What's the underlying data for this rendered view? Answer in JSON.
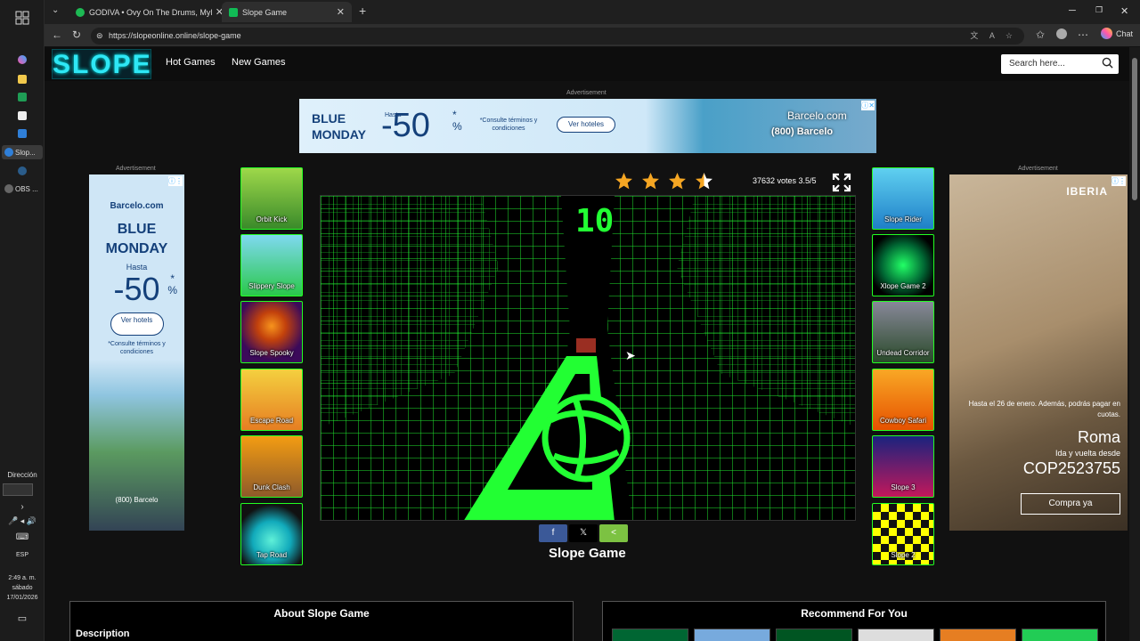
{
  "taskbar": {
    "apps": [
      {
        "label": "Slop...",
        "active": true
      },
      {
        "label": "OBS ...",
        "active": false
      }
    ],
    "direction_label": "Dirección",
    "language": "ESP",
    "time": "2:49 a. m.",
    "day": "sábado",
    "date": "17/01/2026"
  },
  "browser": {
    "tabs": [
      {
        "title": "GODIVA • Ovy On The Drums, Myl",
        "active": false
      },
      {
        "title": "Slope Game",
        "active": true
      }
    ],
    "url": "https://slopeonline.online/slope-game",
    "chat_label": "Chat"
  },
  "site": {
    "logo_text": "SLOPE",
    "nav": [
      "Hot Games",
      "New Games"
    ],
    "search_placeholder": "Search here...",
    "ad_label": "Advertisement",
    "top_ad": {
      "headline_line1": "BLUE",
      "headline_line2": "MONDAY",
      "hasta": "Hasta",
      "discount": "-50",
      "percent": "%",
      "asterisk": "*",
      "note": "*Consulte términos y condiciones",
      "button": "Ver hoteles",
      "brand": "Barcelo.com",
      "brand_sub": "(800) Barcelo"
    },
    "left_ad": {
      "brand": "Barcelo.com",
      "headline_line1": "BLUE",
      "headline_line2": "MONDAY",
      "hasta": "Hasta",
      "discount": "-50",
      "percent": "%",
      "asterisk": "*",
      "button": "Ver hotels",
      "note": "*Consulte términos y condiciones",
      "footer": "(800) Barcelo"
    },
    "right_ad": {
      "brand": "IBERIA",
      "text": "Hasta el 26 de enero. Además, podrás pagar en cuotas.",
      "city": "Roma",
      "trip": "Ida y vuelta desde",
      "price": "COP2523755",
      "button": "Compra ya"
    },
    "left_games": [
      "Orbit Kick",
      "Slippery Slope",
      "Slope Spooky",
      "Escape Road",
      "Dunk Clash",
      "Tap Road"
    ],
    "right_games": [
      "Slope Rider",
      "Xlope Game 2",
      "Undead Corridor",
      "Cowboy Safari",
      "Slope 3",
      "Slope 2"
    ],
    "game": {
      "score": "10",
      "votes": "37632 votes 3.5/5",
      "rating": 3.5,
      "title": "Slope Game"
    },
    "share": {
      "facebook": "f",
      "x": "𝕏",
      "share": "<"
    },
    "about_title": "About Slope Game",
    "description_label": "Description",
    "recommend_title": "Recommend For You"
  },
  "colors": {
    "neon_green": "#22ff33",
    "accent_cyan": "#2ee7f5",
    "star": "#f5a623"
  }
}
